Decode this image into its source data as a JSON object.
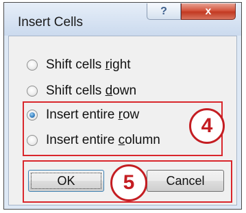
{
  "dialog": {
    "title": "Insert Cells",
    "help_glyph": "?",
    "close_glyph": "x",
    "close_color": "#c8432b"
  },
  "options": [
    {
      "pre": "Shift cells ",
      "key": "r",
      "post": "ight",
      "checked": false
    },
    {
      "pre": "Shift cells ",
      "key": "d",
      "post": "own",
      "checked": false
    },
    {
      "pre": "Insert entire ",
      "key": "r",
      "post": "ow",
      "checked": true
    },
    {
      "pre": "Insert entire ",
      "key": "c",
      "post": "olumn",
      "checked": false
    }
  ],
  "buttons": {
    "ok_label": "OK",
    "cancel_label": "Cancel"
  },
  "annotations": {
    "step_4": "4",
    "step_5": "5",
    "highlight_color": "#d9262b"
  }
}
